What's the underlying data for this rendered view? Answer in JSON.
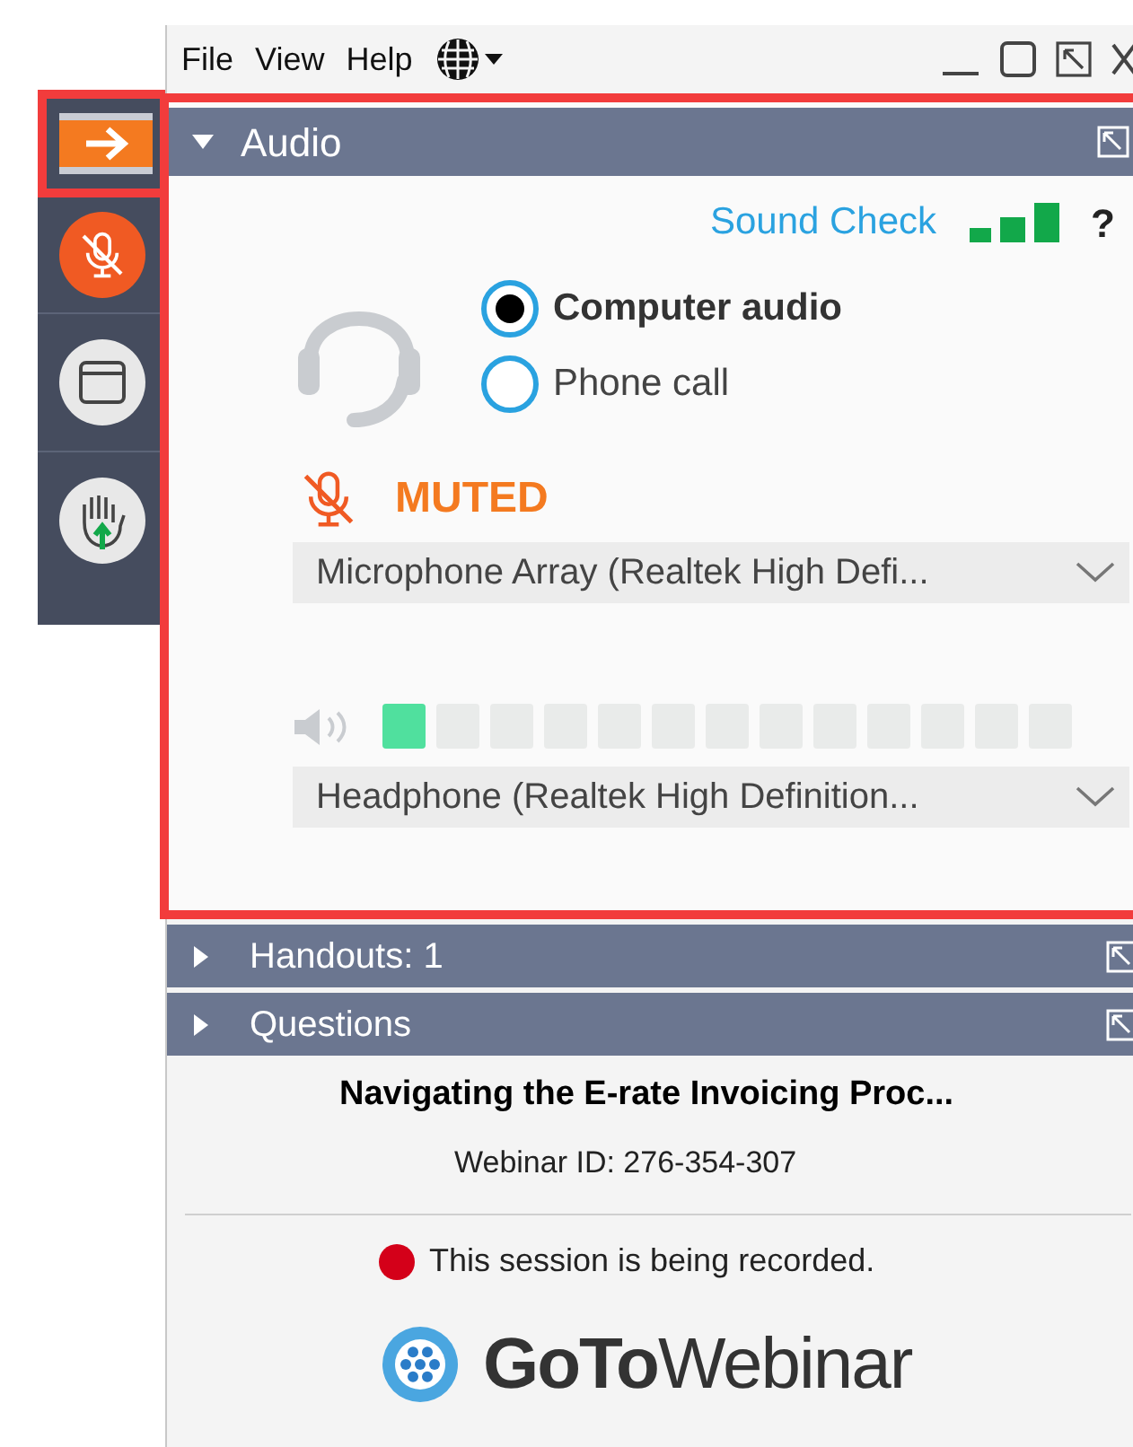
{
  "menu": [
    "File",
    "View",
    "Help"
  ],
  "sidebar": {
    "mic_muted": true
  },
  "audio": {
    "title": "Audio",
    "expanded": true,
    "sound_check": "Sound Check",
    "help": "?",
    "options": [
      {
        "label": "Computer audio",
        "selected": true
      },
      {
        "label": "Phone call",
        "selected": false
      }
    ],
    "mic_status": {
      "muted": true,
      "label": "MUTED"
    },
    "microphone": "Microphone Array (Realtek High Defi...",
    "speaker_meter": {
      "level": 0.077
    },
    "speaker": "Headphone (Realtek High Definition..."
  },
  "panels": [
    {
      "title": "Handouts: 1",
      "expanded": false
    },
    {
      "title": "Questions",
      "expanded": false
    }
  ],
  "webinar": {
    "title": "Navigating the E-rate Invoicing Proc...",
    "id": "Webinar ID: 276-354-307",
    "recording": "This session is being recorded."
  },
  "logo": "**GoTo**Webinar"
}
